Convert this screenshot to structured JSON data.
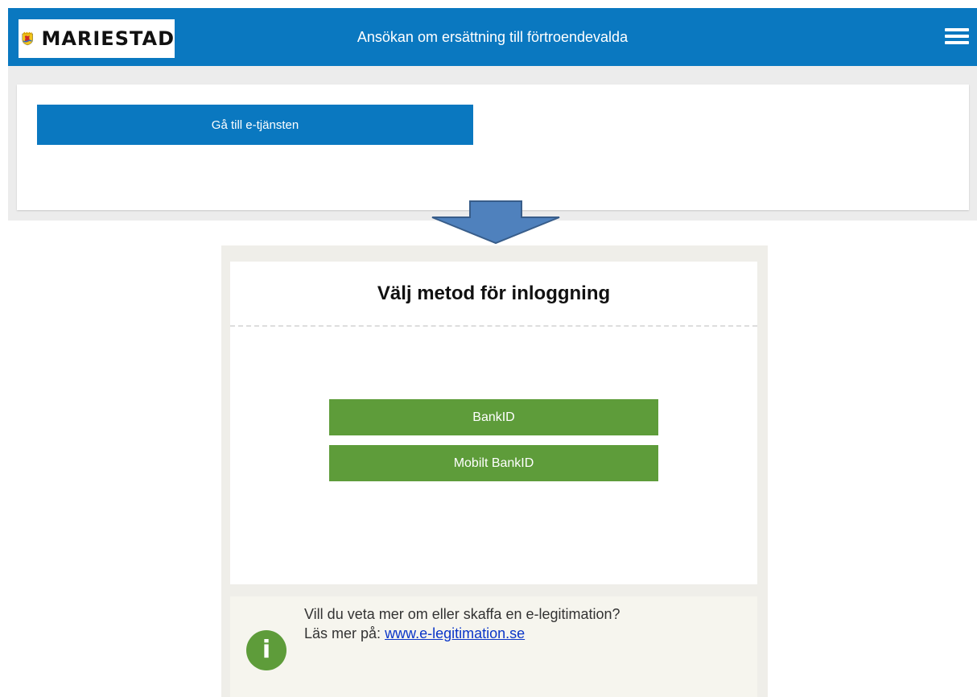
{
  "colors": {
    "header_blue": "#0a78c0",
    "login_green": "#5e9c3a",
    "arrow_fill": "#4f81bd",
    "link_blue": "#0a35c8"
  },
  "header": {
    "logo_text": "MARIESTAD",
    "title": "Ansökan om ersättning till förtroendevalda",
    "menu_icon": "hamburger-icon"
  },
  "top_card": {
    "goto_button_label": "Gå till e-tjänsten"
  },
  "arrow_icon": "arrow-down-icon",
  "login": {
    "title": "Välj metod för inloggning",
    "buttons": [
      {
        "label": "BankID"
      },
      {
        "label": "Mobilt BankID"
      }
    ]
  },
  "info": {
    "icon": "info-icon",
    "line1": "Vill du veta mer om eller skaffa en e-legitimation?",
    "line2_prefix": "Läs mer på:",
    "link_text": "www.e-legitimation.se"
  }
}
